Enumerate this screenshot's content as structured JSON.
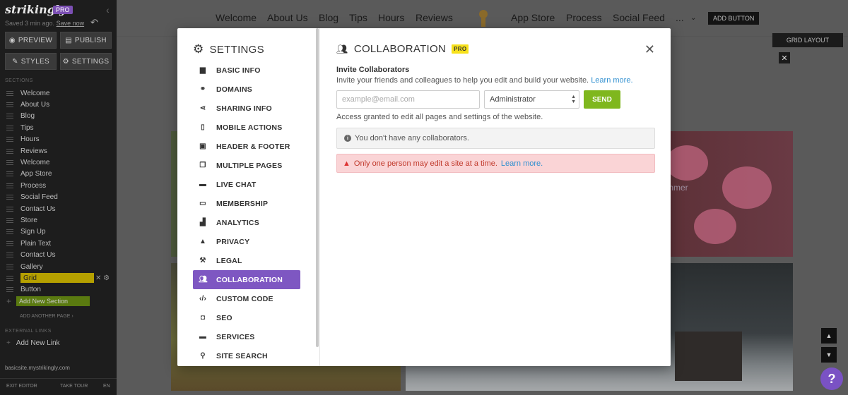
{
  "sidebar": {
    "logo": "strikingly",
    "pro": "PRO",
    "saved_prefix": "Saved 3 min ago.",
    "save_now": "Save now",
    "buttons": {
      "preview": "PREVIEW",
      "publish": "PUBLISH",
      "styles": "STYLES",
      "settings": "SETTINGS"
    },
    "sections_header": "SECTIONS",
    "sections": [
      "Welcome",
      "About Us",
      "Blog",
      "Tips",
      "Hours",
      "Reviews",
      "Welcome",
      "App Store",
      "Process",
      "Social Feed",
      "Contact Us",
      "Store",
      "Sign Up",
      "Plain Text",
      "Contact Us",
      "Gallery",
      "Grid",
      "Button"
    ],
    "active_section": "Grid",
    "add_section": "Add New Section",
    "add_page": "ADD ANOTHER PAGE ›",
    "external_header": "EXTERNAL LINKS",
    "add_link": "Add New Link",
    "site_url": "basicsite.mystrikingly.com",
    "footer": {
      "exit": "EXIT EDITOR",
      "tour": "TAKE TOUR",
      "lang": "EN"
    }
  },
  "topnav": {
    "items": [
      "Welcome",
      "About Us",
      "Blog",
      "Tips",
      "Hours",
      "Reviews",
      "App Store",
      "Process",
      "Social Feed",
      "..."
    ],
    "add_button": "ADD BUTTON",
    "grid_layout": "GRID LAYOUT"
  },
  "page": {
    "summer_text": "mmer"
  },
  "modal": {
    "title": "SETTINGS",
    "nav": [
      {
        "label": "BASIC INFO",
        "icon": "briefcase-icon"
      },
      {
        "label": "DOMAINS",
        "icon": "link-icon"
      },
      {
        "label": "SHARING INFO",
        "icon": "share-icon"
      },
      {
        "label": "MOBILE ACTIONS",
        "icon": "mobile-icon"
      },
      {
        "label": "HEADER & FOOTER",
        "icon": "header-footer-icon"
      },
      {
        "label": "MULTIPLE PAGES",
        "icon": "pages-icon"
      },
      {
        "label": "LIVE CHAT",
        "icon": "chat-icon"
      },
      {
        "label": "MEMBERSHIP",
        "icon": "id-card-icon"
      },
      {
        "label": "ANALYTICS",
        "icon": "bar-chart-icon"
      },
      {
        "label": "PRIVACY",
        "icon": "lock-icon"
      },
      {
        "label": "LEGAL",
        "icon": "gavel-icon"
      },
      {
        "label": "COLLABORATION",
        "icon": "users-icon"
      },
      {
        "label": "CUSTOM CODE",
        "icon": "code-icon"
      },
      {
        "label": "SEO",
        "icon": "seo-icon"
      },
      {
        "label": "SERVICES",
        "icon": "folder-icon"
      },
      {
        "label": "SITE SEARCH",
        "icon": "search-icon"
      }
    ],
    "active_nav": "COLLABORATION",
    "panel": {
      "title": "COLLABORATION",
      "badge": "PRO",
      "invite_title": "Invite Collaborators",
      "invite_desc": "Invite your friends and colleagues to help you edit and build your website.",
      "learn_more": "Learn more.",
      "email_placeholder": "example@email.com",
      "role_value": "Administrator",
      "send": "SEND",
      "access_text": "Access granted to edit all pages and settings of the website.",
      "no_collab": "You don't have any collaborators.",
      "warning": "Only one person may edit a site at a time.",
      "warning_link": "Learn more."
    }
  },
  "colors": {
    "accent": "#7e57c2",
    "send": "#7fb71e",
    "pro_badge": "#f7e11b",
    "warning_bg": "#fad4d6"
  }
}
